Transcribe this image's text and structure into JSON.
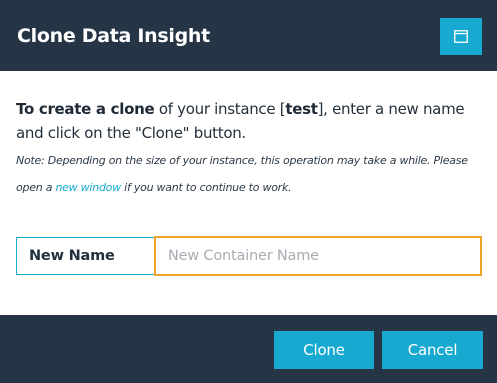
{
  "dialog": {
    "title": "Clone Data Insight",
    "window_icon": "window-icon"
  },
  "message": {
    "intro_bold": "To create a clone",
    "intro_text": " of your instance [",
    "instance_name": "test",
    "intro_rest": "], enter a new name and click on the \"Clone\" button.",
    "note_prefix": "Note: Depending on the size of your instance, this operation may take a while. Please open a ",
    "note_link": "new window",
    "note_suffix": " if you want to continue to work."
  },
  "form": {
    "name_label": "New Name",
    "name_value": "",
    "name_placeholder": "New Container Name"
  },
  "footer": {
    "clone_label": "Clone",
    "cancel_label": "Cancel"
  },
  "colors": {
    "header_bg": "#253545",
    "accent": "#17a9cf",
    "focus_border": "#f0a324"
  }
}
